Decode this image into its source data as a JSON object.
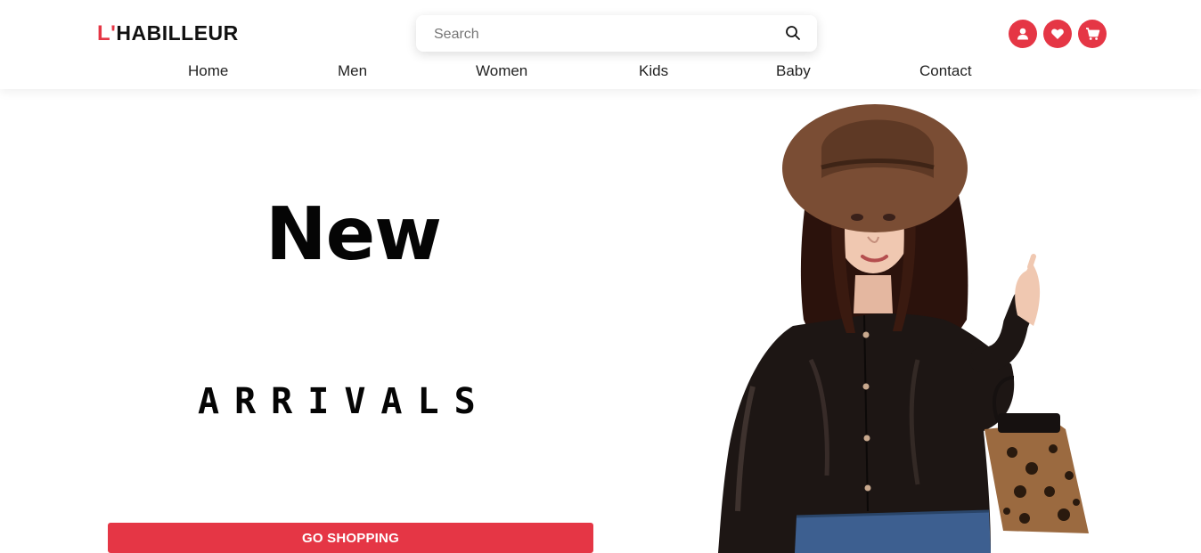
{
  "header": {
    "logo": {
      "accent": "L'",
      "name": "HABILLEUR"
    },
    "search": {
      "placeholder": "Search",
      "value": ""
    },
    "icons": [
      "user-icon",
      "heart-icon",
      "cart-icon"
    ]
  },
  "nav": {
    "items": [
      {
        "label": "Home"
      },
      {
        "label": "Men"
      },
      {
        "label": "Women"
      },
      {
        "label": "Kids"
      },
      {
        "label": "Baby"
      },
      {
        "label": "Contact"
      }
    ]
  },
  "hero": {
    "headline": "New",
    "subheadline": "ARRIVALS",
    "cta_label": "GO SHOPPING"
  },
  "colors": {
    "accent": "#e53645",
    "text": "#111111",
    "background": "#ffffff"
  }
}
